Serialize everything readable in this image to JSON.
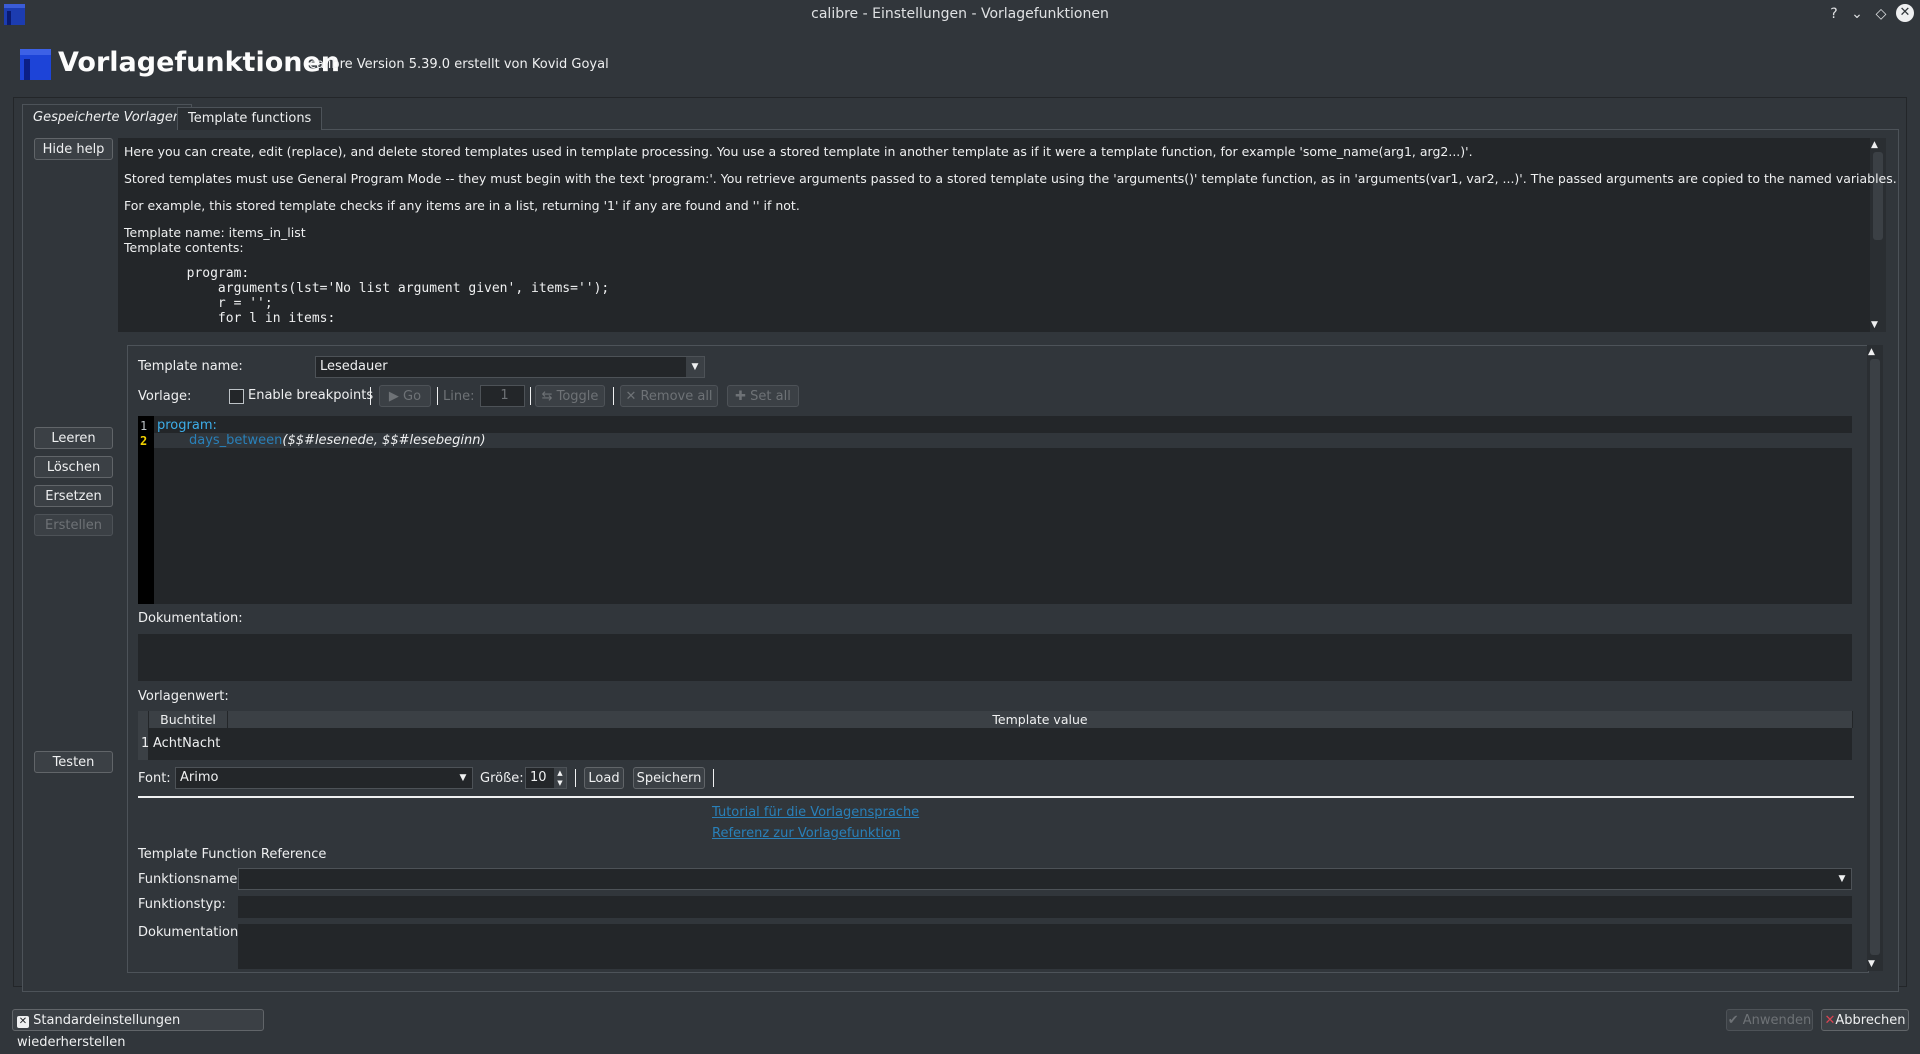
{
  "window": {
    "title": "calibre - Einstellungen - Vorlagefunktionen",
    "buttons": [
      "?",
      "⌄",
      "◇",
      "✕"
    ]
  },
  "header": {
    "title": "Vorlagefunktionen",
    "subtitle": "calibre Version 5.39.0 erstellt von Kovid Goyal"
  },
  "tabs": [
    {
      "label": "Gespeicherte Vorlagen",
      "active": true
    },
    {
      "label": "Template functions",
      "active": false
    }
  ],
  "left_buttons": {
    "hide_help": "Hide help",
    "leeren": "Leeren",
    "loeschen": "Löschen",
    "ersetzen": "Ersetzen",
    "erstellen": "Erstellen",
    "testen": "Testen"
  },
  "help": {
    "p1": "Here you can create, edit (replace), and delete stored templates used in template processing. You use a stored template in another template as if it were a template function, for example 'some_name(arg1, arg2...)'.",
    "p2": "Stored templates must use General Program Mode -- they must begin with the text 'program:'. You retrieve arguments passed to a stored template using the 'arguments()' template function, as in 'arguments(var1, var2, ...)'. The passed arguments are copied to the named variables.",
    "p3": "For example, this stored template checks if any items are in a list, returning '1' if any are found and '' if not.",
    "p4": "Template name: items_in_list",
    "p5": "Template contents:",
    "code": [
      "        program:",
      "            arguments(lst='No list argument given', items='');",
      "            r = '';",
      "            for l in items:"
    ]
  },
  "form": {
    "template_name_label": "Template name:",
    "template_name_value": "Lesedauer",
    "vorlage_label": "Vorlage:",
    "enable_breakpoints": "Enable breakpoints",
    "go": "Go",
    "line_label": "Line:",
    "line_value": "1",
    "toggle": "Toggle",
    "remove_all": "Remove all",
    "set_all": "Set all"
  },
  "editor": {
    "line_numbers": [
      "1",
      "2"
    ],
    "line1": "program:",
    "line2_fn": "days_between",
    "line2_args": "($$#lesenede, $$#lesebeginn)"
  },
  "documentation_label": "Dokumentation:",
  "vorlagenwert_label": "Vorlagenwert:",
  "table": {
    "headers": [
      "Buchtitel",
      "Template value"
    ],
    "rows": [
      {
        "num": "1",
        "title": "AchtNacht",
        "value": ""
      }
    ]
  },
  "font_row": {
    "font_label": "Font:",
    "font_value": "Arimo",
    "size_label": "Größe:",
    "size_value": "10",
    "load": "Load",
    "save": "Speichern"
  },
  "links": {
    "tutorial": "Tutorial für die Vorlagensprache",
    "reference": "Referenz zur Vorlagefunktion"
  },
  "reference": {
    "title": "Template Function Reference",
    "fname_label": "Funktionsname:",
    "ftype_label": "Funktionstyp:",
    "doc_label": "Dokumentation:"
  },
  "footer": {
    "restore": "Standardeinstellungen wiederherstellen",
    "apply": "Anwenden",
    "cancel": "Abbrechen"
  }
}
